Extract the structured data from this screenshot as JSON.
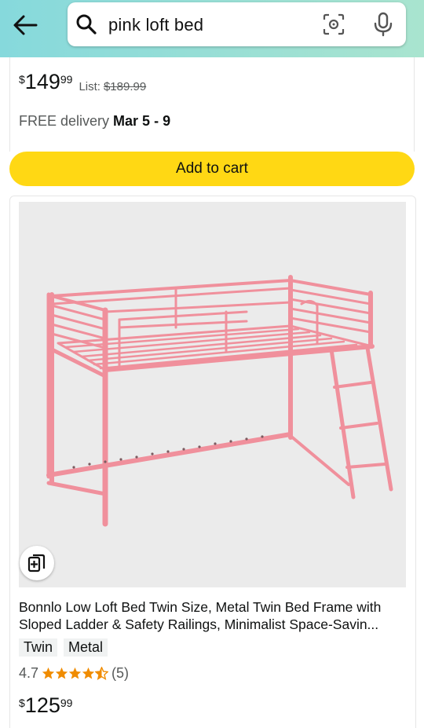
{
  "search": {
    "query": "pink loft bed"
  },
  "icons": {
    "back": "arrow-left-icon",
    "search": "search-icon",
    "lens": "camera-lens-icon",
    "mic": "microphone-icon",
    "save": "save-to-list-icon",
    "star": "star-icon"
  },
  "colors": {
    "header_start": "#86d9dc",
    "header_end": "#a9e4cf",
    "cart_button": "#ffd814",
    "star": "#f08c00",
    "bed_pink": "#f0909c"
  },
  "product1": {
    "currency": "$",
    "price_whole": "149",
    "price_fraction": "99",
    "list_label": "List:",
    "list_price": "$189.99",
    "delivery_prefix": "FREE delivery",
    "delivery_dates": "Mar 5 - 9",
    "cart_label": "Add to cart"
  },
  "product2": {
    "title": "Bonnlo Low Loft Bed Twin Size, Metal Twin Bed Frame with Sloped Ladder & Safety Railings, Minimalist Space-Savin...",
    "tags": [
      "Twin",
      "Metal"
    ],
    "rating": "4.7",
    "rating_value": 4.7,
    "review_count": "(5)",
    "currency": "$",
    "price_whole": "125",
    "price_fraction": "99"
  }
}
